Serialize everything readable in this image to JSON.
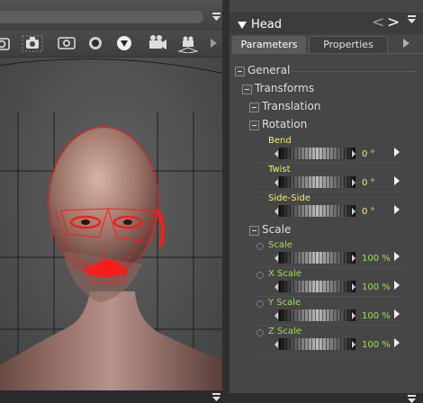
{
  "viewport": {
    "toolbar_icons": [
      "camera-icon",
      "camera-alt-icon",
      "lens-icon",
      "sphere-icon",
      "render-icon",
      "video-camera-icon",
      "ground-camera-icon",
      "scene-camera-icon"
    ]
  },
  "panel": {
    "title": "Head",
    "nav_prev": "<",
    "nav_next": ">",
    "tabs": [
      {
        "label": "Parameters",
        "active": true
      },
      {
        "label": "Properties",
        "active": false
      }
    ],
    "groups": {
      "general": "General",
      "transforms": "Transforms",
      "translation": "Translation",
      "rotation": "Rotation",
      "scale": "Scale"
    },
    "rotation_params": [
      {
        "label": "Bend",
        "value": "0 °"
      },
      {
        "label": "Twist",
        "value": "0 °"
      },
      {
        "label": "Side-Side",
        "value": "0 °"
      }
    ],
    "scale_params": [
      {
        "label": "Scale",
        "value": "100 %"
      },
      {
        "label": "X Scale",
        "value": "100 %"
      },
      {
        "label": "Y Scale",
        "value": "100 %"
      },
      {
        "label": "Z Scale",
        "value": "100 %"
      }
    ]
  },
  "colors": {
    "rotation_text": "#f0f070",
    "scale_text": "#9edf4f",
    "selection_highlight": "#ff1a1a"
  }
}
